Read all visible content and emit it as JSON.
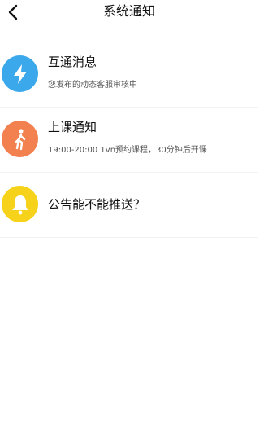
{
  "header": {
    "title": "系统通知",
    "back_icon": "chevron-left-icon"
  },
  "notifications": [
    {
      "icon": "lightning-icon",
      "icon_color": "#3aa8ea",
      "title": "互通消息",
      "subtitle": "您发布的动态客服审核中"
    },
    {
      "icon": "walking-person-icon",
      "icon_color": "#f2814f",
      "title": "上课通知",
      "subtitle": "19:00-20:00 1vn预约课程，30分钟后开课"
    },
    {
      "icon": "bell-icon",
      "icon_color": "#f6d31a",
      "title": "公告能不能推送？"
    }
  ]
}
